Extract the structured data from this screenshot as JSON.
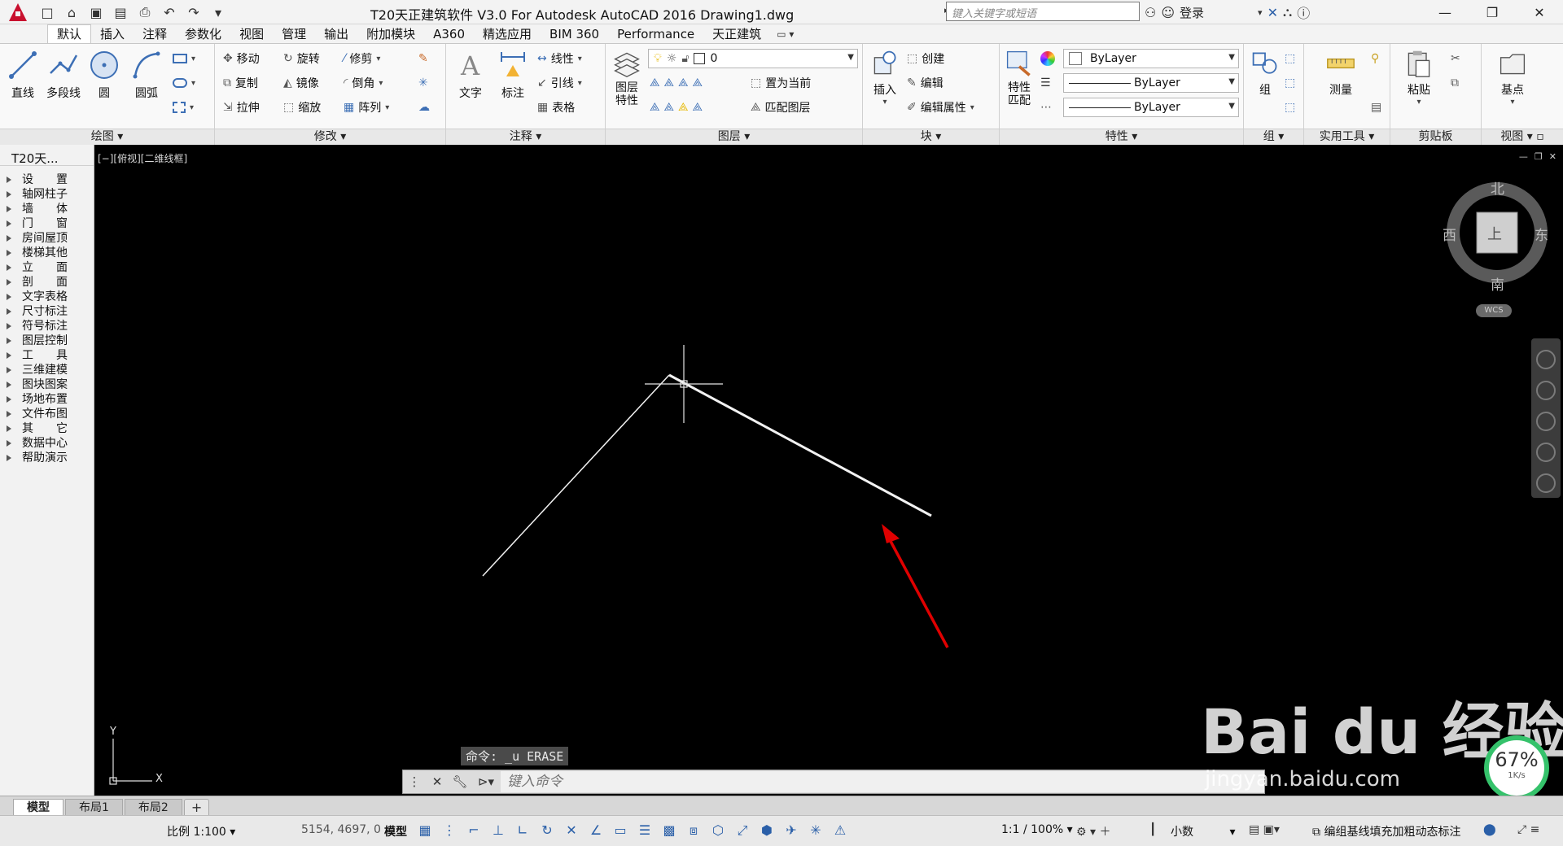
{
  "window": {
    "title": "T20天正建筑软件 V3.0 For Autodesk AutoCAD 2016    Drawing1.dwg",
    "search_placeholder": "键入关键字或短语",
    "login": "登录"
  },
  "tabs": [
    {
      "label": "默认"
    },
    {
      "label": "插入"
    },
    {
      "label": "注释"
    },
    {
      "label": "参数化"
    },
    {
      "label": "视图"
    },
    {
      "label": "管理"
    },
    {
      "label": "输出"
    },
    {
      "label": "附加模块"
    },
    {
      "label": "A360"
    },
    {
      "label": "精选应用"
    },
    {
      "label": "BIM 360"
    },
    {
      "label": "Performance"
    },
    {
      "label": "天正建筑"
    }
  ],
  "active_tab": "默认",
  "ribbon": {
    "draw": {
      "title": "绘图",
      "line": "直线",
      "polyline": "多段线",
      "circle": "圆",
      "arc": "圆弧"
    },
    "modify": {
      "title": "修改",
      "move": "移动",
      "rotate": "旋转",
      "trim": "修剪",
      "copy": "复制",
      "mirror": "镜像",
      "fillet": "倒角",
      "stretch": "拉伸",
      "scale": "缩放",
      "array": "阵列"
    },
    "annotation": {
      "title": "注释",
      "text": "文字",
      "dimension": "标注",
      "linear": "线性",
      "leader": "引线",
      "table": "表格"
    },
    "layers": {
      "title": "图层",
      "properties": "图层\n特性",
      "current_layer": "0",
      "set_current": "置为当前",
      "match_layer": "匹配图层"
    },
    "block": {
      "title": "块",
      "insert": "插入",
      "create": "创建",
      "edit": "编辑",
      "edit_attr": "编辑属性"
    },
    "properties": {
      "title": "特性",
      "match": "特性\n匹配",
      "color": "ByLayer",
      "linetype": "ByLayer",
      "lineweight": "ByLayer"
    },
    "groups": {
      "title": "组",
      "group": "组"
    },
    "utilities": {
      "title": "实用工具",
      "measure": "测量"
    },
    "clipboard": {
      "title": "剪贴板",
      "paste": "粘贴"
    },
    "view": {
      "title": "视图",
      "base": "基点"
    }
  },
  "palette": {
    "title": "T20天...",
    "items": [
      "设　　置",
      "轴网柱子",
      "墙　　体",
      "门　　窗",
      "房间屋顶",
      "楼梯其他",
      "立　　面",
      "剖　　面",
      "文字表格",
      "尺寸标注",
      "符号标注",
      "图层控制",
      "工　　具",
      "三维建模",
      "图块图案",
      "场地布置",
      "文件布图",
      "其　　它",
      "数据中心",
      "帮助演示"
    ]
  },
  "viewport": {
    "label": "[−][俯视][二维线框]",
    "compass": {
      "north": "北",
      "south": "南",
      "east": "东",
      "west": "西",
      "top": "上"
    },
    "wcs": "WCS",
    "ucs_x": "X",
    "ucs_y": "Y",
    "command_hint": "命令: _u ERASE",
    "command_placeholder": "键入命令"
  },
  "watermark": {
    "brand": "Bai du 经验",
    "url": "jingyan.baidu.com"
  },
  "performance": {
    "value": "67%",
    "rate": "1K/s"
  },
  "layout_tabs": [
    {
      "label": "模型"
    },
    {
      "label": "布局1"
    },
    {
      "label": "布局2"
    }
  ],
  "status": {
    "scale": "比例 1:100",
    "coords": "5154, 4697, 0",
    "mode": "模型",
    "annotation_scale": "1:1 / 100%",
    "units": "小数",
    "tianzheng": "编组基线填充加粗动态标注"
  },
  "colors": {
    "accent": "#2a5fa8",
    "brand": "#c8102e",
    "arrow": "#e00000",
    "perf_ring": "#35c26b"
  }
}
